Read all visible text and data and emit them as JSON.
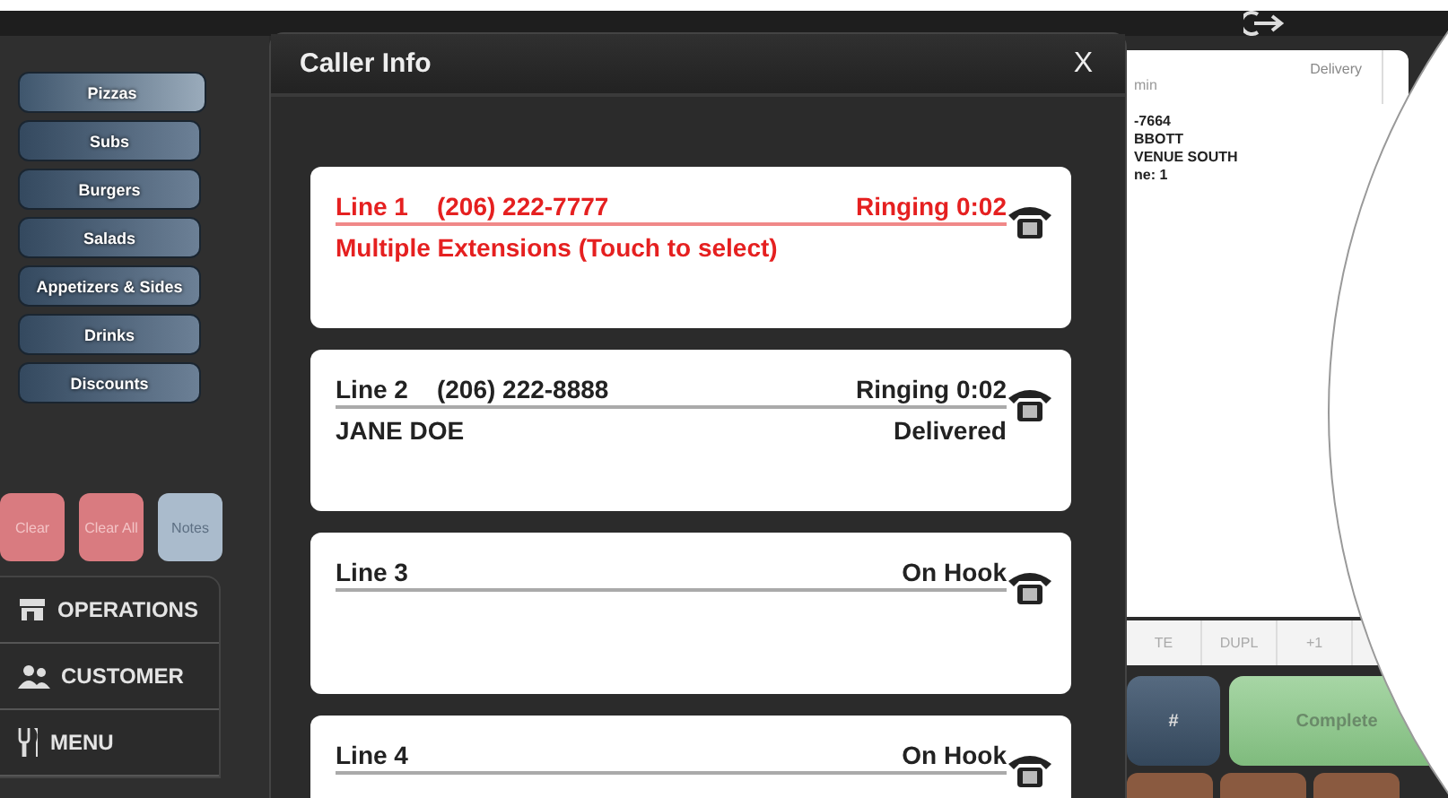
{
  "categories": [
    {
      "label": "Pizzas",
      "selected": true
    },
    {
      "label": "Subs",
      "selected": false
    },
    {
      "label": "Burgers",
      "selected": false
    },
    {
      "label": "Salads",
      "selected": false
    },
    {
      "label": "Appetizers & Sides",
      "selected": false
    },
    {
      "label": "Drinks",
      "selected": false
    },
    {
      "label": "Discounts",
      "selected": false
    }
  ],
  "order_buttons": [
    {
      "label": "Clear",
      "kind": "clear"
    },
    {
      "label": "Clear All",
      "kind": "clear"
    },
    {
      "label": "Notes",
      "kind": "notes"
    }
  ],
  "nav": [
    {
      "label": "OPERATIONS",
      "kind": "store"
    },
    {
      "label": "CUSTOMER",
      "kind": "people"
    },
    {
      "label": "MENU",
      "kind": "cutlery"
    }
  ],
  "dialog": {
    "title": "Caller Info",
    "close": "X",
    "lines": [
      {
        "line": "Line 1",
        "phone": "(206) 222-7777",
        "status": "Ringing 0:02",
        "detail": "Multiple Extensions (Touch to select)",
        "ringing": true
      },
      {
        "line": "Line 2",
        "phone": "(206) 222-8888",
        "status": "Ringing 0:02",
        "detail": "JANE DOE",
        "detail_status": "Delivered",
        "ringing": false
      },
      {
        "line": "Line 3",
        "status": "On Hook",
        "ringing": false
      },
      {
        "line": "Line 4",
        "status": "On Hook",
        "ringing": false
      }
    ]
  },
  "receipt": {
    "order_type": "Delivery",
    "lines": [
      "min",
      "-7664",
      "BBOTT",
      "VENUE SOUTH",
      "ne: 1"
    ]
  },
  "action_tabs": [
    "TE",
    "DUPL",
    "+1"
  ],
  "keys": [
    {
      "label": "#",
      "kind": "key"
    },
    {
      "label": "Complete",
      "kind": "complete"
    }
  ]
}
